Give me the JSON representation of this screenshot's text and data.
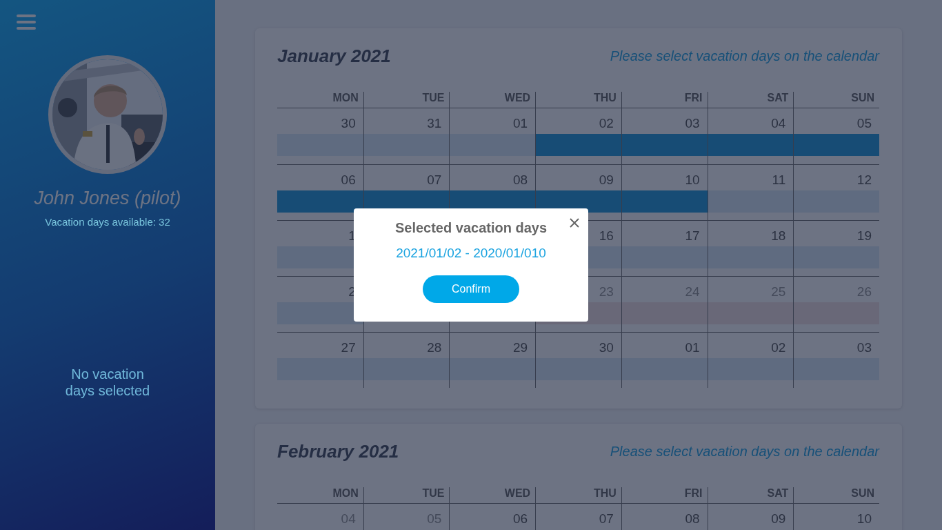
{
  "sidebar": {
    "name": "John Jones (pilot)",
    "available": "Vacation days available: 32",
    "selection_status": "No vacation days selected"
  },
  "months": [
    {
      "title": "January 2021",
      "hint": "Please select vacation days on the calendar",
      "weekdays": [
        "MON",
        "TUE",
        "WED",
        "THU",
        "FRI",
        "SAT",
        "SUN"
      ],
      "weeks": [
        [
          {
            "day": "30",
            "disabled": false,
            "kind": "free"
          },
          {
            "day": "31",
            "disabled": false,
            "kind": "free"
          },
          {
            "day": "01",
            "disabled": false,
            "kind": "free"
          },
          {
            "day": "02",
            "disabled": false,
            "kind": "selected"
          },
          {
            "day": "03",
            "disabled": false,
            "kind": "selected"
          },
          {
            "day": "04",
            "disabled": false,
            "kind": "selected"
          },
          {
            "day": "05",
            "disabled": false,
            "kind": "selected"
          }
        ],
        [
          {
            "day": "06",
            "disabled": false,
            "kind": "selected"
          },
          {
            "day": "07",
            "disabled": false,
            "kind": "selected"
          },
          {
            "day": "08",
            "disabled": false,
            "kind": "selected"
          },
          {
            "day": "09",
            "disabled": false,
            "kind": "selected"
          },
          {
            "day": "10",
            "disabled": false,
            "kind": "selected"
          },
          {
            "day": "11",
            "disabled": false,
            "kind": "free"
          },
          {
            "day": "12",
            "disabled": false,
            "kind": "free"
          }
        ],
        [
          {
            "day": "1",
            "disabled": false,
            "kind": "free"
          },
          {
            "kind": "covered"
          },
          {
            "kind": "covered"
          },
          {
            "day": "16",
            "disabled": false,
            "kind": "free"
          },
          {
            "day": "17",
            "disabled": false,
            "kind": "free"
          },
          {
            "day": "18",
            "disabled": false,
            "kind": "free"
          },
          {
            "day": "19",
            "disabled": false,
            "kind": "free"
          }
        ],
        [
          {
            "day": "2",
            "disabled": false,
            "kind": "free"
          },
          {
            "kind": "covered"
          },
          {
            "kind": "covered"
          },
          {
            "day": "23",
            "disabled": true,
            "kind": "blocked"
          },
          {
            "day": "24",
            "disabled": true,
            "kind": "blocked"
          },
          {
            "day": "25",
            "disabled": true,
            "kind": "blocked"
          },
          {
            "day": "26",
            "disabled": true,
            "kind": "blocked"
          }
        ],
        [
          {
            "day": "27",
            "disabled": false,
            "kind": "free"
          },
          {
            "day": "28",
            "disabled": false,
            "kind": "free"
          },
          {
            "day": "29",
            "disabled": false,
            "kind": "free"
          },
          {
            "day": "30",
            "disabled": false,
            "kind": "free"
          },
          {
            "day": "01",
            "disabled": false,
            "kind": "free"
          },
          {
            "day": "02",
            "disabled": false,
            "kind": "free"
          },
          {
            "day": "03",
            "disabled": false,
            "kind": "free"
          }
        ]
      ]
    },
    {
      "title": "February 2021",
      "hint": "Please select vacation days on the calendar",
      "weekdays": [
        "MON",
        "TUE",
        "WED",
        "THU",
        "FRI",
        "SAT",
        "SUN"
      ],
      "weeks": [
        [
          {
            "day": "04",
            "disabled": true
          },
          {
            "day": "05",
            "disabled": true
          },
          {
            "day": "06",
            "disabled": false
          },
          {
            "day": "07",
            "disabled": false
          },
          {
            "day": "08",
            "disabled": false
          },
          {
            "day": "09",
            "disabled": false
          },
          {
            "day": "10",
            "disabled": false
          }
        ]
      ]
    }
  ],
  "dialog": {
    "title": "Selected vacation days",
    "range": "2021/01/02 - 2020/01/010",
    "confirm": "Confirm"
  }
}
